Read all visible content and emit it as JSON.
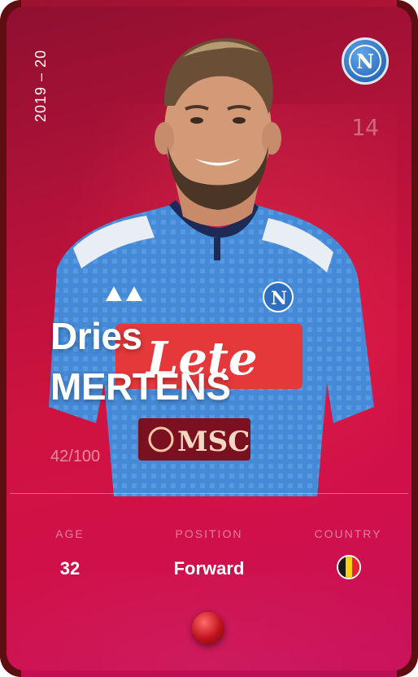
{
  "card": {
    "season": "2019 – 20",
    "jersey_number": "14",
    "club_badge_letter": "N",
    "first_name": "Dries",
    "last_name": "MERTENS",
    "serial": "42/100",
    "colors": {
      "frame": "#5e0d10",
      "background": "#c8123f",
      "jersey": "#4b92dd"
    }
  },
  "stats": {
    "age_label": "AGE",
    "age_value": "32",
    "position_label": "POSITION",
    "position_value": "Forward",
    "country_label": "COUNTRY",
    "country_flag": "belgium-flag-icon"
  },
  "jersey": {
    "sponsor_main": "Lete",
    "sponsor_secondary": "MSC"
  }
}
